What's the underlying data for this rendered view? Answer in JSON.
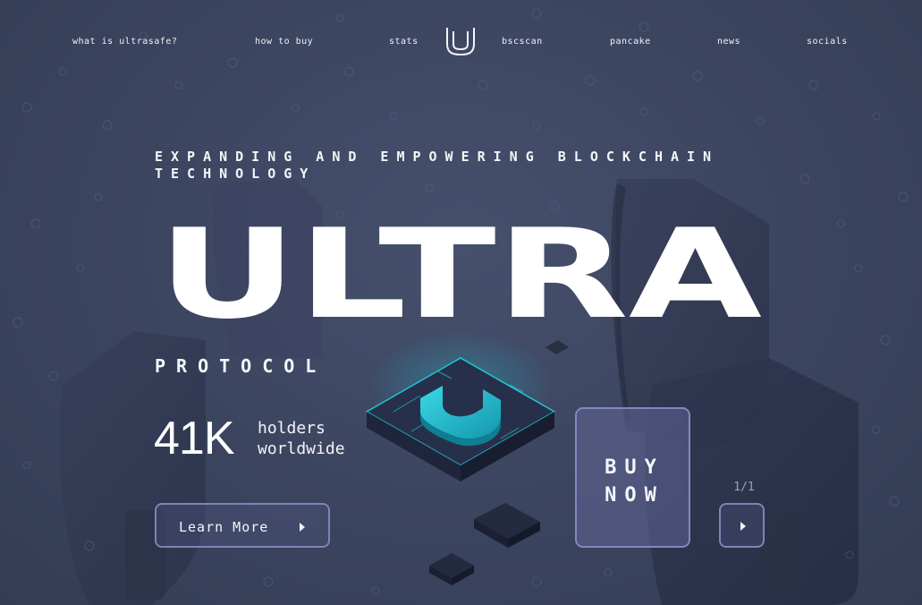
{
  "nav": {
    "items": [
      {
        "label": "what is ultrasafe?"
      },
      {
        "label": "how to buy"
      },
      {
        "label": "stats"
      },
      {
        "label": "bscscan"
      },
      {
        "label": "pancake"
      },
      {
        "label": "news"
      },
      {
        "label": "socials"
      }
    ],
    "logo_icon": "ultra-u-logo-icon"
  },
  "hero": {
    "tagline": "EXPANDING AND EMPOWERING BLOCKCHAIN TECHNOLOGY",
    "title": "ULTRA",
    "subtitle": "PROTOCOL",
    "stat_value": "41K",
    "stat_label": "holders worldwide",
    "learn_more_label": "Learn More",
    "buy_label": "BUY\nNOW",
    "pager": "1/1"
  },
  "icons": {
    "arrow": "play-arrow-icon",
    "illustration": "isometric-u-chip-icon",
    "background": "shield-pattern-icon"
  },
  "colors": {
    "background": "#3d4661",
    "accent_teal": "#1ec8d8",
    "button_border": "#7f83b6",
    "buy_fill": "#62649a",
    "text": "#f4f5fa"
  }
}
